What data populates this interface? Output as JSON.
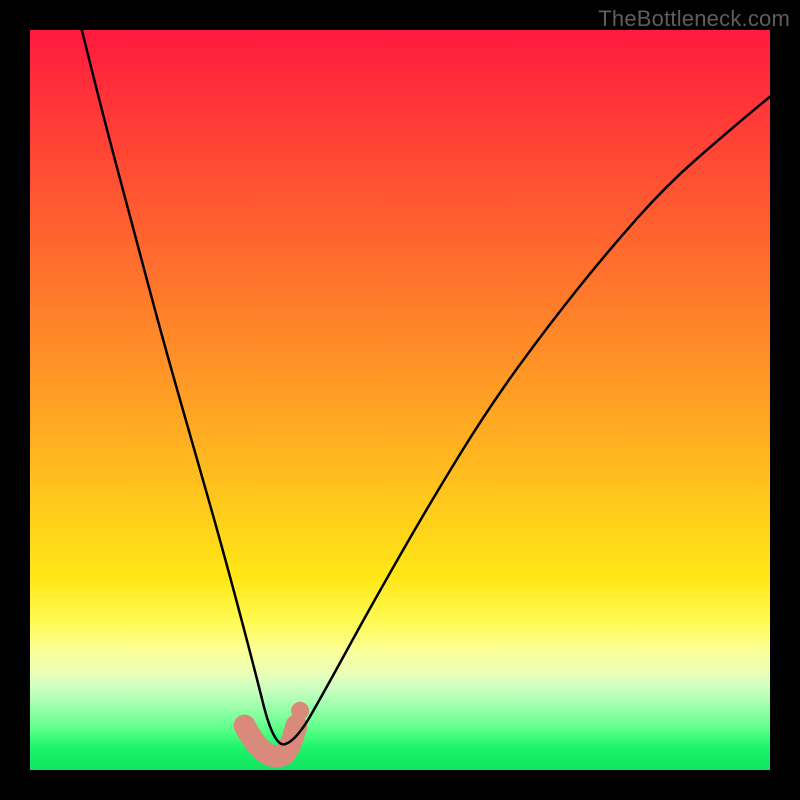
{
  "watermark": "TheBottleneck.com",
  "chart_data": {
    "type": "line",
    "title": "",
    "xlabel": "",
    "ylabel": "",
    "xlim": [
      0,
      100
    ],
    "ylim": [
      0,
      100
    ],
    "grid": false,
    "legend": false,
    "description": "V-shaped bottleneck curve over a red-to-green vertical gradient; minimum (optimal) near x≈33, y≈0. A salmon highlight blob marks the trough.",
    "series": [
      {
        "name": "curve",
        "x": [
          7,
          10,
          14,
          18,
          22,
          26,
          30,
          33,
          36,
          40,
          46,
          54,
          62,
          70,
          78,
          86,
          94,
          100
        ],
        "values": [
          100,
          88,
          73,
          58,
          44,
          30,
          15,
          3,
          4,
          11,
          22,
          36,
          49,
          60,
          70,
          79,
          86,
          91
        ]
      }
    ],
    "optimal_point": {
      "x": 33,
      "y": 2
    }
  }
}
